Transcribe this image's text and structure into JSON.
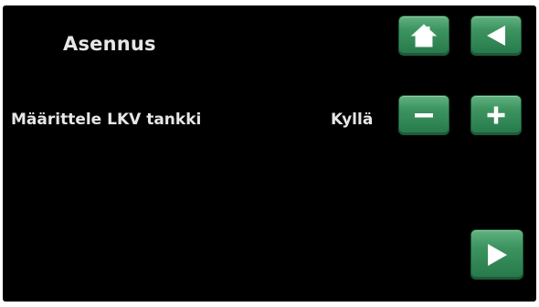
{
  "header": {
    "title": "Asennus"
  },
  "setting": {
    "label": "Määrittele LKV tankki",
    "value": "Kyllä"
  },
  "buttons": {
    "home_icon": "home-icon",
    "back_icon": "arrow-left-icon",
    "minus_icon": "minus-icon",
    "plus_icon": "plus-icon",
    "next_icon": "arrow-right-icon"
  },
  "colors": {
    "background": "#000000",
    "text": "#e6e6e6",
    "button_green": "#3d9460"
  }
}
